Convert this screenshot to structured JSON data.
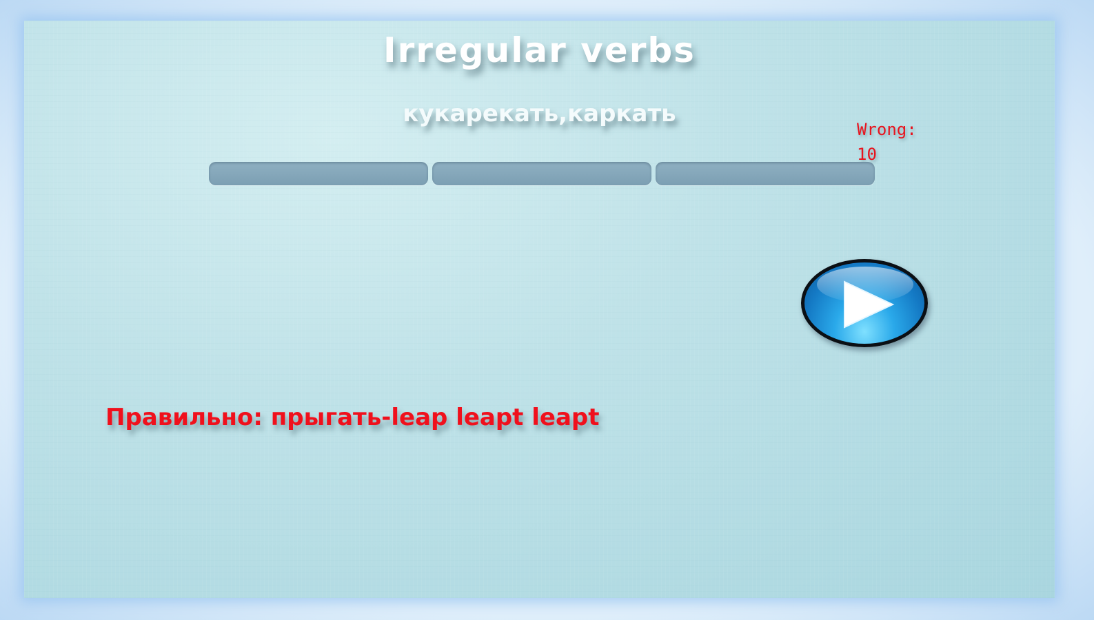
{
  "game": {
    "title": "Irregular verbs",
    "prompt_word": "кукарекать,каркать",
    "wrong_label": "Wrong:",
    "wrong_count": "10",
    "answer_fields": [
      {
        "value": ""
      },
      {
        "value": ""
      },
      {
        "value": ""
      }
    ],
    "next_button_icon": "play-icon",
    "feedback": "Правильно: прыгать-leap leapt leapt"
  },
  "colors": {
    "background": "#bfe2e8",
    "title_text": "#ffffff",
    "error_text": "#e8141e",
    "answer_field": "#8fb0c2",
    "play_button": "#2aa9ea"
  }
}
